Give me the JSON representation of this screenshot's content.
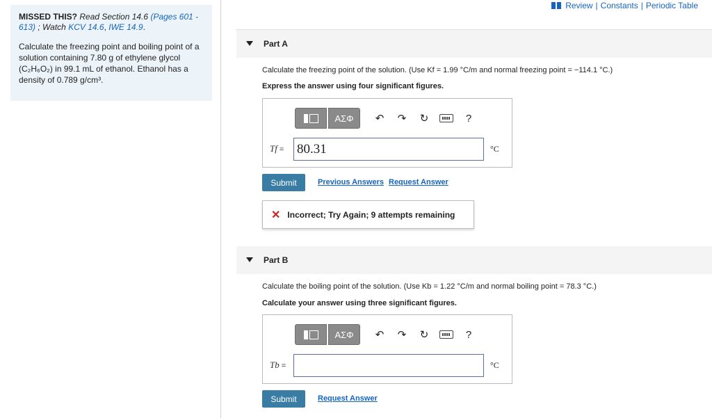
{
  "topbar": {
    "review": "Review",
    "constants": "Constants",
    "periodic": "Periodic Table",
    "sep": "|"
  },
  "left": {
    "missed_label": "MISSED THIS?",
    "read_section": "Read Section",
    "section": "14.6",
    "pages": "(Pages 601 - 613)",
    "watch": "; Watch",
    "kcv": "KCV 14.6",
    "iwe": "IWE 14.9",
    "problem_text": "Calculate the freezing point and boiling point of a solution containing 7.80 g of ethylene glycol (C₂H₆O₂) in 99.1 mL of ethanol. Ethanol has a density of 0.789 g/cm³."
  },
  "colors": {
    "accent": "#1565c0",
    "submit_bg": "#3a7da4",
    "error": "#c62828",
    "panel_bg": "#edf4f9"
  },
  "partA": {
    "title": "Part A",
    "question": "Calculate the freezing point of the solution. (Use Kf = 1.99 °C/m and normal freezing point = −114.1 °C.)",
    "instruction": "Express the answer using four significant figures.",
    "var_label": "Tf",
    "answer_value": "80.31",
    "unit": "°C",
    "submit": "Submit",
    "previous_answers": "Previous Answers",
    "request_answer": "Request Answer",
    "feedback": "Incorrect; Try Again; 9 attempts remaining"
  },
  "partB": {
    "title": "Part B",
    "question": "Calculate the boiling point of the solution. (Use Kb = 1.22 °C/m and normal boiling point = 78.3 °C.)",
    "instruction": "Calculate your answer using three significant figures.",
    "var_label": "Tb",
    "answer_value": "",
    "unit": "°C",
    "submit": "Submit",
    "request_answer": "Request Answer"
  },
  "toolbar": {
    "greek_label": "ΑΣΦ",
    "help": "?",
    "undo_icon": "↶",
    "redo_icon": "↷",
    "reset_icon": "↻"
  },
  "equals": "="
}
